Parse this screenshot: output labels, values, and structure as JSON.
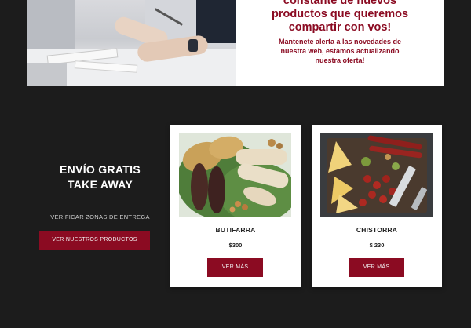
{
  "banner": {
    "headline_lines": [
      "constante de nuevos",
      "productos que queremos",
      "compartir con vos!"
    ],
    "sub_lines": [
      "Mantenete alerta a las novedades de",
      "nuestra web, estamos actualizando",
      "nuestra oferta!"
    ],
    "accent_color": "#8b0b22"
  },
  "promo": {
    "title_lines": [
      "ENVÍO GRATIS",
      "TAKE AWAY"
    ],
    "zone_link": "VERIFICAR ZONAS DE ENTREGA",
    "products_button": "VER NUESTROS PRODUCTOS"
  },
  "products": [
    {
      "name": "BUTIFARRA",
      "price": "$300",
      "button": "VER MÁS"
    },
    {
      "name": "CHISTORRA",
      "price": "$ 230",
      "button": "VER MÁS"
    }
  ],
  "colors": {
    "page_bg": "#1c1c1c",
    "brand": "#8b0b22",
    "card_bg": "#ffffff"
  }
}
